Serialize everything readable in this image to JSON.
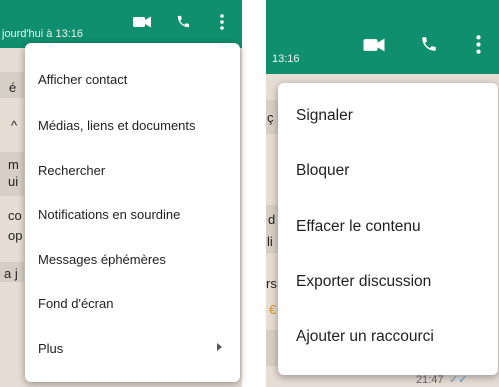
{
  "left": {
    "status_text": "jourd'hui à 13:16",
    "chat_fragments": [
      "é",
      "^",
      "m",
      "ui",
      "co",
      "op",
      "a j"
    ],
    "menu": [
      {
        "label": "Afficher contact"
      },
      {
        "label": "Médias, liens et documents"
      },
      {
        "label": "Rechercher"
      },
      {
        "label": "Notifications en sourdine"
      },
      {
        "label": "Messages éphémères"
      },
      {
        "label": "Fond d'écran"
      },
      {
        "label": "Plus"
      }
    ]
  },
  "right": {
    "status_text": "13:16",
    "chat_fragments": [
      "ç",
      "d",
      "li",
      "rs",
      "€"
    ],
    "time_text": "21:47",
    "menu": [
      {
        "label": "Signaler"
      },
      {
        "label": "Bloquer"
      },
      {
        "label": "Effacer le contenu"
      },
      {
        "label": "Exporter discussion"
      },
      {
        "label": "Ajouter un raccourci"
      }
    ]
  },
  "icons": {
    "video": "video-call-icon",
    "phone": "voice-call-icon",
    "overflow": "more-options-icon",
    "submenu": "submenu-arrow-icon",
    "read": "read-receipt-icon"
  },
  "colors": {
    "appbar": "#0f8f6e",
    "chat_background": "#e6ddd4",
    "menu_background": "#ffffff",
    "menu_text": "#1f1f1f",
    "read_receipt": "#5a9fd4"
  }
}
